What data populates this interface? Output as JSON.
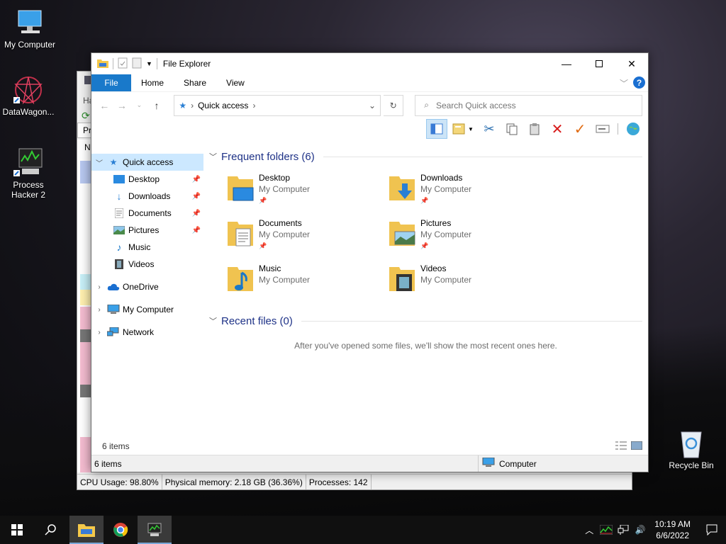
{
  "desktop": {
    "icons": [
      {
        "label": "My Computer",
        "icon": "monitor-icon"
      },
      {
        "label": "DataWagon...",
        "icon": "datawagon-icon"
      },
      {
        "label": "Process Hacker 2",
        "icon": "process-hacker-icon"
      },
      {
        "label": "Recycle Bin",
        "icon": "recycle-bin-icon"
      }
    ]
  },
  "process_hacker": {
    "menu_fragment": "Ha",
    "tab_fragment": "Pro",
    "col_fragment": "N",
    "status": {
      "cpu": "CPU Usage: 98.80%",
      "memory": "Physical memory: 2.18 GB (36.36%)",
      "processes": "Processes: 142"
    }
  },
  "explorer": {
    "title": "File Explorer",
    "tabs": {
      "file": "File",
      "home": "Home",
      "share": "Share",
      "view": "View"
    },
    "help": "?",
    "address": {
      "location": "Quick access"
    },
    "search": {
      "placeholder": "Search Quick access"
    },
    "nav": {
      "quick_access": "Quick access",
      "pinned": [
        {
          "label": "Desktop",
          "pinned": true
        },
        {
          "label": "Downloads",
          "pinned": true
        },
        {
          "label": "Documents",
          "pinned": true
        },
        {
          "label": "Pictures",
          "pinned": true
        },
        {
          "label": "Music",
          "pinned": false
        },
        {
          "label": "Videos",
          "pinned": false
        }
      ],
      "onedrive": "OneDrive",
      "my_computer": "My Computer",
      "network": "Network"
    },
    "frequent": {
      "header": "Frequent folders (6)",
      "folders": [
        {
          "name": "Desktop",
          "location": "My Computer",
          "pinned": true
        },
        {
          "name": "Downloads",
          "location": "My Computer",
          "pinned": true
        },
        {
          "name": "Documents",
          "location": "My Computer",
          "pinned": true
        },
        {
          "name": "Pictures",
          "location": "My Computer",
          "pinned": true
        },
        {
          "name": "Music",
          "location": "My Computer",
          "pinned": false
        },
        {
          "name": "Videos",
          "location": "My Computer",
          "pinned": false
        }
      ]
    },
    "recent": {
      "header": "Recent files (0)",
      "empty": "After you've opened some files, we'll show the most recent ones here."
    },
    "item_count": "6 items",
    "status_left": "6 items",
    "status_right": "Computer"
  },
  "taskbar": {
    "time": "10:19 AM",
    "date": "6/6/2022"
  },
  "colors": {
    "accent": "#1979ca",
    "selection": "#cce8ff",
    "group_header": "#1e3287"
  }
}
